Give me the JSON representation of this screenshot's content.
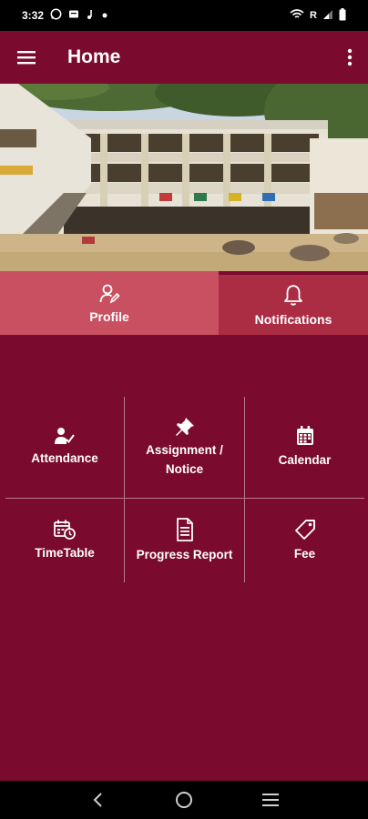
{
  "status_bar": {
    "time": "3:32",
    "carrier_indicator": "R",
    "icons": [
      "whatsapp-icon",
      "message-icon",
      "music-icon",
      "dot-icon",
      "wifi-icon",
      "signal-icon",
      "battery-icon"
    ]
  },
  "app_bar": {
    "title": "Home",
    "menu_icon": "hamburger-menu-icon",
    "more_icon": "more-vertical-icon"
  },
  "banner": {
    "icon": "school-building-photo"
  },
  "tabs": [
    {
      "label": "Profile",
      "icon": "user-profile-icon",
      "active": false
    },
    {
      "label": "Notifications",
      "icon": "bell-icon",
      "active": true
    }
  ],
  "grid": {
    "items": [
      {
        "label": "Attendance",
        "icon": "attendance-icon"
      },
      {
        "label": "Assignment /\nNotice",
        "icon": "pushpin-icon"
      },
      {
        "label": "Calendar",
        "icon": "calendar-icon"
      },
      {
        "label": "TimeTable",
        "icon": "timetable-icon"
      },
      {
        "label": "Progress Report",
        "icon": "document-icon"
      },
      {
        "label": "Fee",
        "icon": "tag-icon"
      }
    ]
  },
  "nav_bar": {
    "icons": [
      "back-icon",
      "home-icon",
      "recents-icon"
    ]
  },
  "colors": {
    "primary": "#7a0a2e",
    "tab_profile": "#c95061",
    "tab_notifications": "#ab2d44",
    "system_bar": "#000000"
  }
}
